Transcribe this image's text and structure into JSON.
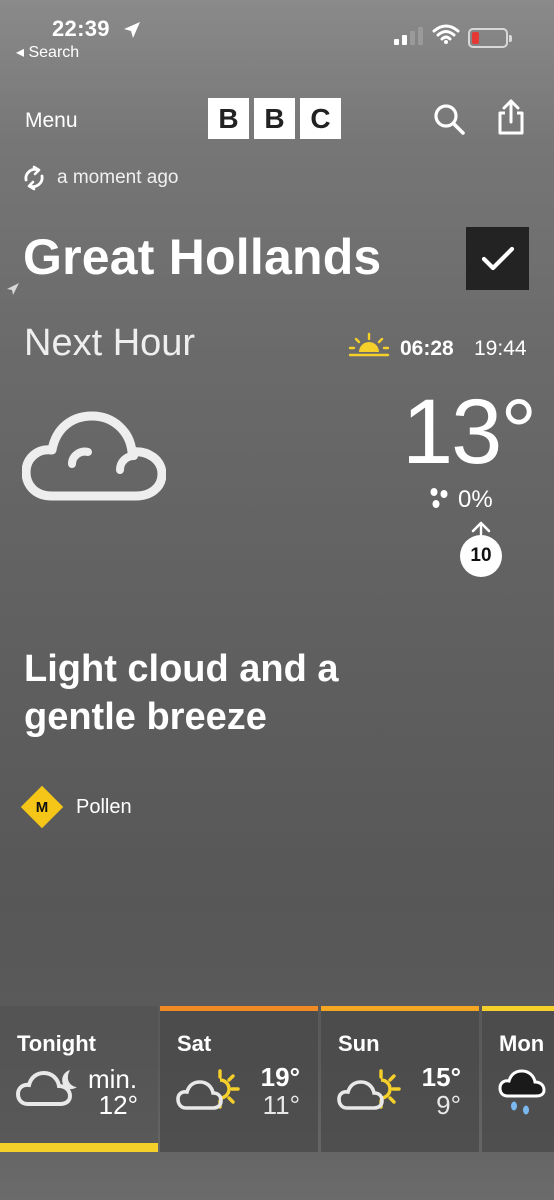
{
  "status_bar": {
    "time": "22:39",
    "back_label": "◂ Search"
  },
  "header": {
    "menu_label": "Menu",
    "bbc_letters": [
      "B",
      "B",
      "C"
    ]
  },
  "updated": "a moment ago",
  "location": {
    "name": "Great Hollands",
    "favourite": true
  },
  "now": {
    "heading": "Next Hour",
    "sunrise": "06:28",
    "sunset": "19:44",
    "temperature": "13°",
    "rain_chance": "0%",
    "wind_speed": "10",
    "condition_icon": "cloud-icon"
  },
  "summary": "Light cloud and a gentle breeze",
  "pollen": {
    "level": "M",
    "label": "Pollen",
    "color": "#f5c518"
  },
  "forecast": [
    {
      "day": "Tonight",
      "min_label": "min.",
      "low": "12°",
      "icon": "cloud-moon-icon"
    },
    {
      "day": "Sat",
      "high": "19°",
      "low": "11°",
      "icon": "sun-cloud-icon"
    },
    {
      "day": "Sun",
      "high": "15°",
      "low": "9°",
      "icon": "sun-cloud-icon"
    },
    {
      "day": "Mon",
      "icon": "rain-cloud-icon"
    }
  ],
  "colors": {
    "accent_yellow": "#f5d02a",
    "accent_orange": "#f08a24",
    "battery_low": "#e53935"
  }
}
